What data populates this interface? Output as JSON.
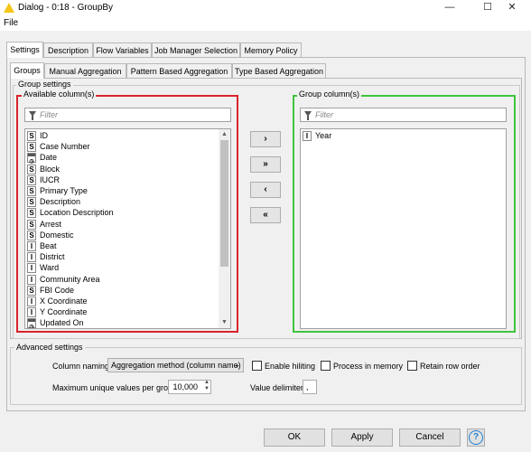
{
  "window": {
    "title": "Dialog - 0:18 - GroupBy",
    "minimize": "—",
    "maximize": "☐",
    "close": "✕"
  },
  "menu": {
    "file": "File"
  },
  "tabs": [
    "Settings",
    "Description",
    "Flow Variables",
    "Job Manager Selection",
    "Memory Policy"
  ],
  "subtabs": [
    "Groups",
    "Manual Aggregation",
    "Pattern Based Aggregation",
    "Type Based Aggregation"
  ],
  "group_settings": {
    "legend": "Group settings",
    "available": {
      "legend": "Available column(s)",
      "filter_placeholder": "Filter",
      "items": [
        {
          "type": "S",
          "label": "ID"
        },
        {
          "type": "S",
          "label": "Case Number"
        },
        {
          "type": "D",
          "label": "Date"
        },
        {
          "type": "S",
          "label": "Block"
        },
        {
          "type": "S",
          "label": "IUCR"
        },
        {
          "type": "S",
          "label": "Primary Type"
        },
        {
          "type": "S",
          "label": "Description"
        },
        {
          "type": "S",
          "label": "Location Description"
        },
        {
          "type": "S",
          "label": "Arrest"
        },
        {
          "type": "S",
          "label": "Domestic"
        },
        {
          "type": "I",
          "label": "Beat"
        },
        {
          "type": "I",
          "label": "District"
        },
        {
          "type": "I",
          "label": "Ward"
        },
        {
          "type": "I",
          "label": "Community Area"
        },
        {
          "type": "S",
          "label": "FBI Code"
        },
        {
          "type": "I",
          "label": "X Coordinate"
        },
        {
          "type": "I",
          "label": "Y Coordinate"
        },
        {
          "type": "D",
          "label": "Updated On"
        }
      ]
    },
    "buttons": {
      "add": "›",
      "add_all": "»",
      "remove": "‹",
      "remove_all": "«"
    },
    "group": {
      "legend": "Group column(s)",
      "filter_placeholder": "Filter",
      "items": [
        {
          "type": "I",
          "label": "Year"
        }
      ]
    }
  },
  "advanced": {
    "legend": "Advanced settings",
    "column_naming_label": "Column naming:",
    "column_naming_value": "Aggregation method (column name)",
    "enable_hiliting": "Enable hiliting",
    "process_in_memory": "Process in memory",
    "retain_row_order": "Retain row order",
    "max_unique_label": "Maximum unique values per group",
    "max_unique_value": "10,000",
    "value_delimiter_label": "Value delimiter",
    "value_delimiter_value": ","
  },
  "footer": {
    "ok": "OK",
    "apply": "Apply",
    "cancel": "Cancel",
    "help": "?"
  },
  "colors": {
    "available_border": "#d9242b",
    "group_border": "#3fc43f",
    "help": "#1e7fd6"
  }
}
